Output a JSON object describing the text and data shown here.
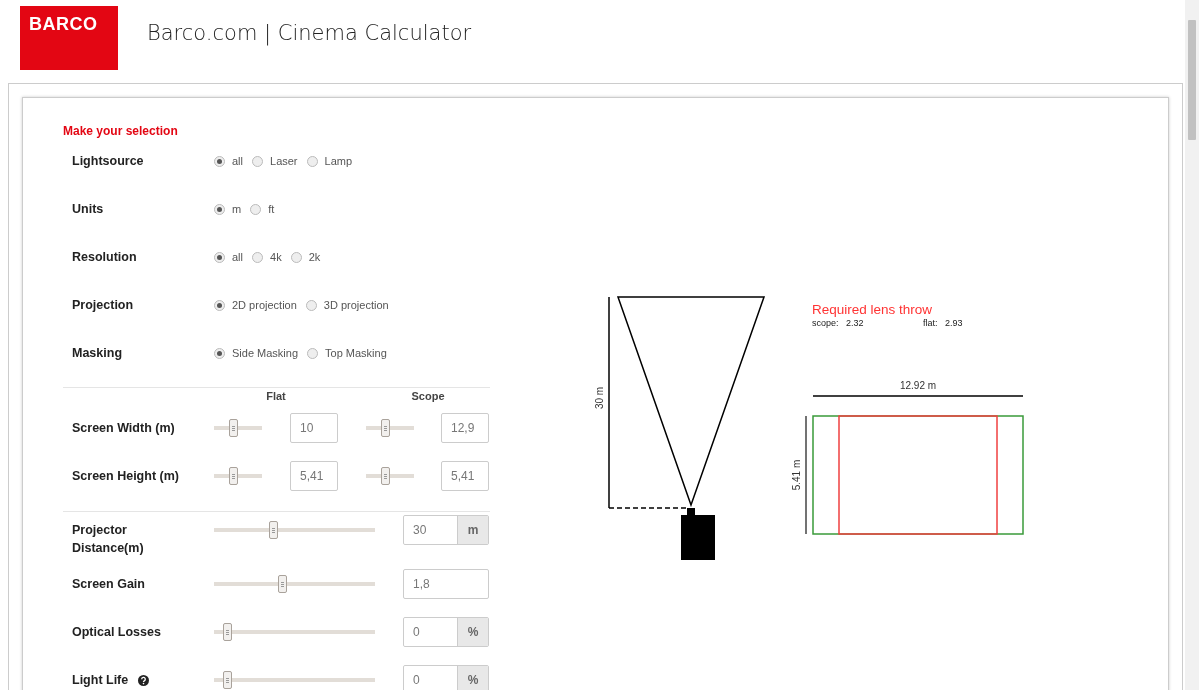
{
  "header": {
    "logo": "BARCO",
    "title": "Barco.com | Cinema Calculator"
  },
  "selection": {
    "heading": "Make your selection",
    "groups": [
      {
        "label": "Lightsource",
        "options": [
          {
            "label": "all",
            "selected": true
          },
          {
            "label": "Laser",
            "selected": false
          },
          {
            "label": "Lamp",
            "selected": false
          }
        ]
      },
      {
        "label": "Units",
        "options": [
          {
            "label": "m",
            "selected": true
          },
          {
            "label": "ft",
            "selected": false
          }
        ]
      },
      {
        "label": "Resolution",
        "options": [
          {
            "label": "all",
            "selected": true
          },
          {
            "label": "4k",
            "selected": false
          },
          {
            "label": "2k",
            "selected": false
          }
        ]
      },
      {
        "label": "Projection",
        "options": [
          {
            "label": "2D projection",
            "selected": true
          },
          {
            "label": "3D projection",
            "selected": false
          }
        ]
      },
      {
        "label": "Masking",
        "options": [
          {
            "label": "Side Masking",
            "selected": true
          },
          {
            "label": "Top Masking",
            "selected": false
          }
        ]
      }
    ]
  },
  "dimensions": {
    "columns": [
      "Flat",
      "Scope"
    ],
    "rows": [
      {
        "label": "Screen Width (m)",
        "flat": {
          "level": 0.38,
          "value": "10"
        },
        "scope": {
          "level": 0.38,
          "value": "12,9"
        }
      },
      {
        "label": "Screen Height (m)",
        "flat": {
          "level": 0.38,
          "value": "5,41"
        },
        "scope": {
          "level": 0.38,
          "value": "5,41"
        }
      }
    ]
  },
  "settings": [
    {
      "label": "Projector Distance(m)",
      "help": false,
      "level": 0.36,
      "value": "30",
      "unit": "m"
    },
    {
      "label": "Screen Gain",
      "help": false,
      "level": 0.42,
      "value": "1,8"
    },
    {
      "label": "Optical Losses",
      "help": false,
      "level": 0.06,
      "value": "0",
      "unit": "%"
    },
    {
      "label": "Light Life",
      "help": true,
      "level": 0.06,
      "value": "0",
      "unit": "%"
    }
  ],
  "throw_diagram": {
    "distance_label": "30 m"
  },
  "lens_throw": {
    "title": "Required lens throw",
    "scope_label": "scope:",
    "scope": "2.32",
    "flat_label": "flat:",
    "flat": "2.93"
  },
  "screen_diagram": {
    "width_label": "12.92 m",
    "height_label": "5.41 m"
  }
}
